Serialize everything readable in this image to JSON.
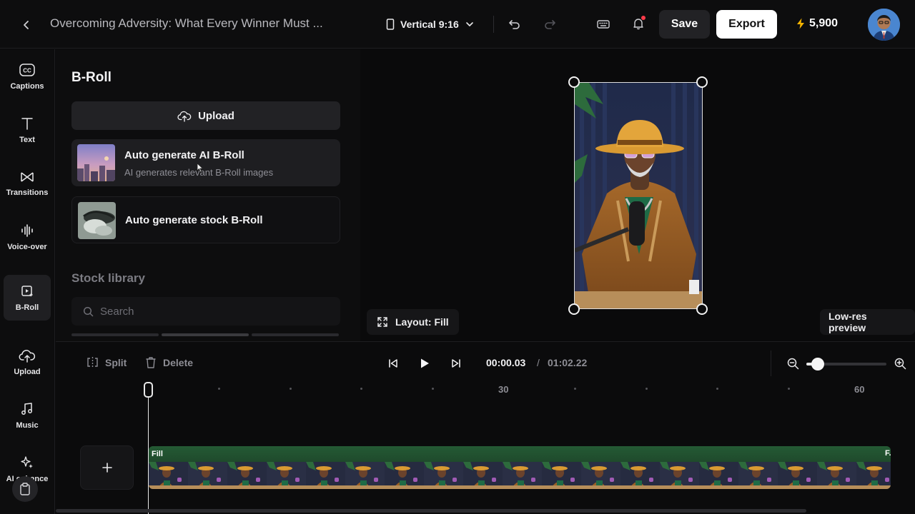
{
  "header": {
    "title": "Overcoming Adversity: What Every Winner Must ...",
    "aspect_label": "Vertical 9:16",
    "save_label": "Save",
    "export_label": "Export",
    "credits": "5,900"
  },
  "sidebar": {
    "items": [
      {
        "label": "Captions",
        "icon": "captions-icon"
      },
      {
        "label": "Text",
        "icon": "text-icon"
      },
      {
        "label": "Transitions",
        "icon": "transitions-icon"
      },
      {
        "label": "Voice-over",
        "icon": "waveform-icon"
      },
      {
        "label": "B-Roll",
        "icon": "broll-icon",
        "active": true
      },
      {
        "label": "Upload",
        "icon": "cloud-upload-icon"
      },
      {
        "label": "Music",
        "icon": "music-note-icon"
      },
      {
        "label": "AI enhance",
        "icon": "sparkle-icon"
      }
    ]
  },
  "panel": {
    "title": "B-Roll",
    "upload_label": "Upload",
    "ai_card": {
      "title": "Auto generate AI B-Roll",
      "subtitle": "AI generates relevant B-Roll images"
    },
    "stock_card": {
      "title": "Auto generate stock B-Roll"
    },
    "stock_library_title": "Stock library",
    "search_placeholder": "Search"
  },
  "preview": {
    "layout_label": "Layout: Fill",
    "lowres_label": "Low-res preview"
  },
  "timeline": {
    "split_label": "Split",
    "delete_label": "Delete",
    "current_time": "00:00.03",
    "separator": "/",
    "total_time": "01:02.22",
    "ruler_labels": [
      "30",
      "60"
    ],
    "zoom_level": 0.14,
    "track_label": "Fill",
    "track_end_label": "F."
  },
  "colors": {
    "background": "#0b0b0c",
    "panel": "#0d0d0e",
    "button": "#222225",
    "accent_bolt": "#f5b400",
    "track_green": "#245a34",
    "notification": "#ff3b4a"
  }
}
